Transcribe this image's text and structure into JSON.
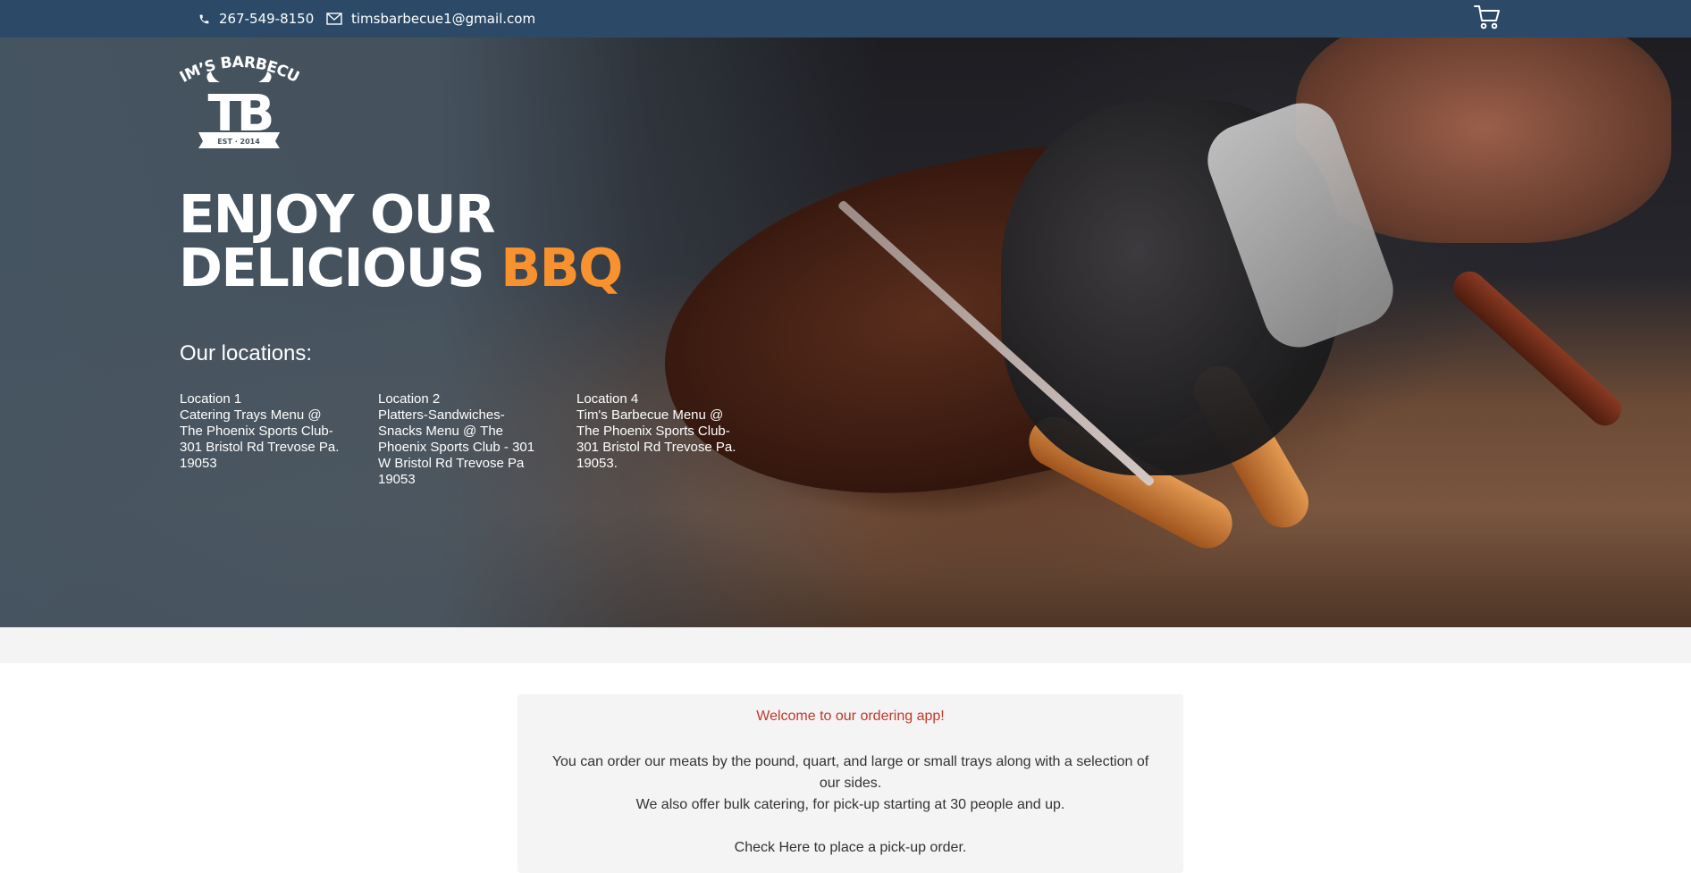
{
  "topbar": {
    "phone": "267-549-8150",
    "email": "timsbarbecue1@gmail.com",
    "cart_icon": "shopping-cart-icon",
    "background_color": "#2c4a68"
  },
  "logo": {
    "brand_text": "TIM'S BARBECUE",
    "monogram": "TB",
    "est": "EST 2014"
  },
  "hero": {
    "headline_line1": "ENJOY OUR",
    "headline_line2_plain": "DELICIOUS",
    "headline_line2_accent": "BBQ",
    "accent_color": "#f7922f",
    "locations_title": "Our locations:",
    "locations": [
      {
        "label": "Location 1",
        "line": "Catering Trays Menu @ The Phoenix Sports Club-301 Bristol Rd Trevose Pa. 19053"
      },
      {
        "label": "Location 2",
        "line": "Platters-Sandwiches-Snacks Menu @ The Phoenix Sports Club - 301 W Bristol Rd Trevose Pa 19053"
      },
      {
        "label": "Location 4",
        "line": "Tim's Barbecue Menu @ The Phoenix Sports Club-301 Bristol Rd Trevose Pa. 19053."
      }
    ]
  },
  "info": {
    "welcome": "Welcome to our ordering app!",
    "paragraph1": "You can order our meats by the pound, quart, and large or small trays along with a selection of our sides.",
    "paragraph2": "We also offer bulk catering, for pick-up starting at 30 people and up.",
    "paragraph3": "Check Here to place a pick-up order.",
    "welcome_color": "#c0392b"
  }
}
